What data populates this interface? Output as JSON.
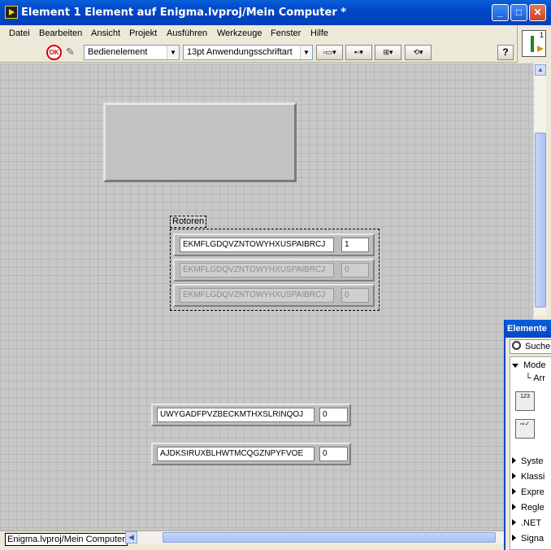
{
  "window": {
    "title": "Element 1 Element auf Enigma.lvproj/Mein Computer *",
    "buttons": {
      "minimize": "_",
      "maximize": "□",
      "close": "✕"
    }
  },
  "menu": [
    "Datei",
    "Bearbeiten",
    "Ansicht",
    "Projekt",
    "Ausführen",
    "Werkzeuge",
    "Fenster",
    "Hilfe"
  ],
  "toolbar": {
    "control_type": "Bedienelement",
    "font": "13pt Anwendungsschriftart",
    "help": "?",
    "run_icon": "ok-run-icon",
    "connector_number": "1"
  },
  "front_panel": {
    "array_label": "Rotoren",
    "rotors": [
      {
        "string": "EKMFLGDQVZNTOWYHXUSPAIBRCJ",
        "number": "1"
      },
      {
        "string": "EKMFLGDQVZNTOWYHXUSPAIBRCJ",
        "number": "0"
      },
      {
        "string": "EKMFLGDQVZNTOWYHXUSPAIBRCJ",
        "number": "0"
      }
    ],
    "clusters": [
      {
        "string": "UWYGADFPVZBECKMTHXSLRINQOJ",
        "number": "0"
      },
      {
        "string": "AJDKSIRUXBLHWTMCQGZNPYFVOE",
        "number": "0"
      }
    ]
  },
  "status": {
    "path": "Enigma.lvproj/Mein Computer"
  },
  "palette": {
    "title": "Elemente",
    "search": "Suche",
    "items": [
      "Mode",
      "Arr",
      "Syste",
      "Klassi",
      "Expre",
      "Regle",
      ".NET",
      "Signa"
    ],
    "icon_label": "123"
  }
}
